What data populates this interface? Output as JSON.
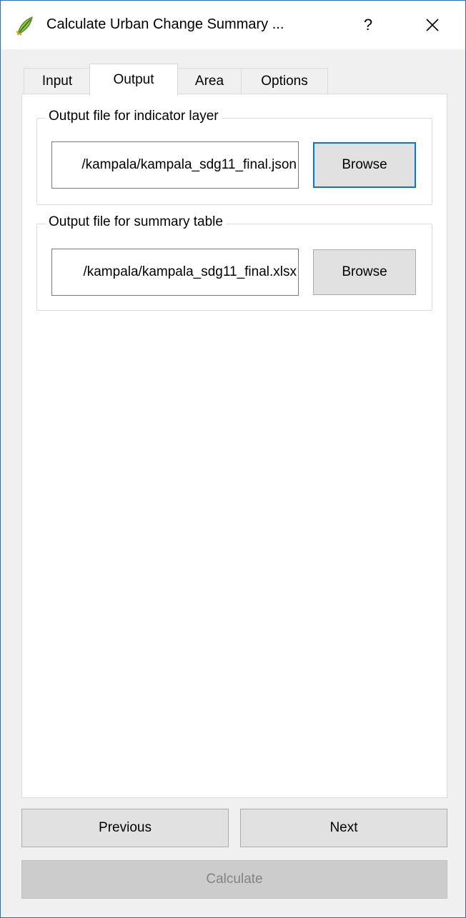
{
  "window": {
    "title": "Calculate Urban Change Summary ...",
    "help_label": "?",
    "close_icon": "close-icon",
    "app_icon": "qgis-icon",
    "colors": {
      "accent": "#0078d7",
      "frame": "#2b6fb0",
      "qgis_green": "#5a9a2a"
    }
  },
  "tabs": [
    {
      "label": "Input",
      "active": false
    },
    {
      "label": "Output",
      "active": true
    },
    {
      "label": "Area",
      "active": false
    },
    {
      "label": "Options",
      "active": false
    }
  ],
  "groups": [
    {
      "title": "Output file for indicator layer",
      "value": "/kampala/kampala_sdg11_final.json",
      "browse_label": "Browse",
      "browse_focused": true
    },
    {
      "title": "Output file for summary table",
      "value": "/kampala/kampala_sdg11_final.xlsx",
      "browse_label": "Browse",
      "browse_focused": false
    }
  ],
  "footer": {
    "previous_label": "Previous",
    "next_label": "Next",
    "calculate_label": "Calculate",
    "calculate_enabled": false
  }
}
